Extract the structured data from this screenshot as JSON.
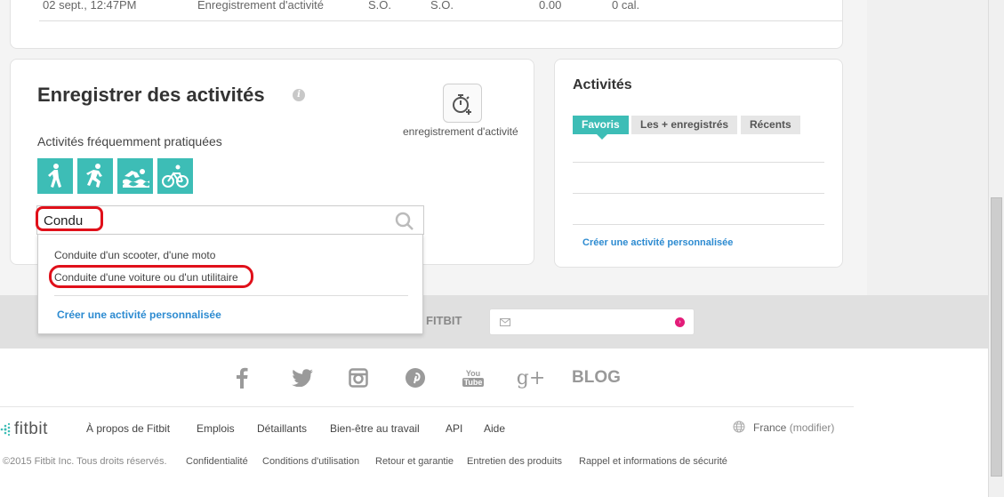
{
  "top_row": {
    "date": "02 sept., 12:47PM",
    "type": "Enregistrement d'activité",
    "col1": "S.O.",
    "col2": "S.O.",
    "col3": "0.00",
    "col4": "0 cal."
  },
  "log": {
    "title": "Enregistrer des activités",
    "info": "i",
    "frequent_label": "Activités fréquemment pratiquées",
    "frequent_icons": [
      "walking-icon",
      "running-icon",
      "swimming-icon",
      "cycling-icon"
    ],
    "stopwatch_label": "enregistrement d'activité",
    "search_value": "Condu",
    "suggestions": [
      "Conduite d'un scooter, d'une moto",
      "Conduite d'une voiture ou d'un utilitaire"
    ],
    "create_custom": "Créer une activité personnalisée"
  },
  "activities": {
    "title": "Activités",
    "tabs": [
      "Favoris",
      "Les + enregistrés",
      "Récents"
    ],
    "create_custom": "Créer une activité personnalisée"
  },
  "band": {
    "text": "FITBIT"
  },
  "footer": {
    "social_icons": [
      "facebook-icon",
      "twitter-icon",
      "instagram-icon",
      "pinterest-icon",
      "youtube-icon",
      "google-plus-icon"
    ],
    "youtube_text": "You Tube",
    "google_plus_text": "g+",
    "blog": "BLOG",
    "logo": "fitbit",
    "links": [
      "À propos de Fitbit",
      "Emplois",
      "Détaillants",
      "Bien-être au travail",
      "API",
      "Aide"
    ],
    "country": "France",
    "modify": "(modifier)",
    "copyright": "©2015 Fitbit Inc. Tous droits réservés.",
    "legal_links": [
      "Confidentialité",
      "Conditions d'utilisation",
      "Retour et garantie",
      "Entretien des produits",
      "Rappel et informations de sécurité"
    ]
  },
  "colors": {
    "teal": "#3dbdb6",
    "link_blue": "#2d8bd1",
    "annotation_red": "#e0101a",
    "pink": "#e31c79"
  }
}
